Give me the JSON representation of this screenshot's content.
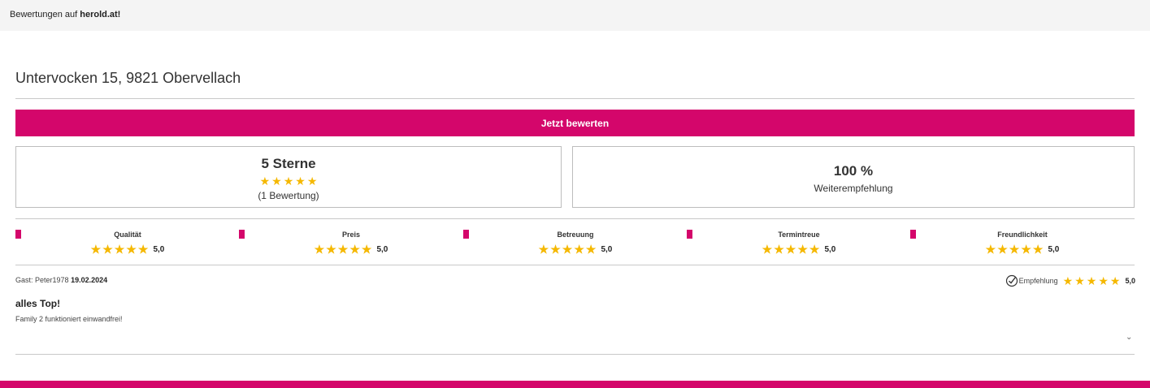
{
  "topbar": {
    "prefix": "Bewertungen auf ",
    "brand": "herold.at!"
  },
  "address": "Untervocken 15, 9821 Obervellach",
  "cta_label": "Jetzt bewerten",
  "summary": {
    "stars_title": "5 Sterne",
    "stars_value": 5,
    "count_label": "(1 Bewertung)",
    "recommend_percent": "100 %",
    "recommend_label": "Weiterempfehlung"
  },
  "categories": [
    {
      "label": "Qualität",
      "value": "5,0",
      "stars": 5
    },
    {
      "label": "Preis",
      "value": "5,0",
      "stars": 5
    },
    {
      "label": "Betreuung",
      "value": "5,0",
      "stars": 5
    },
    {
      "label": "Termintreue",
      "value": "5,0",
      "stars": 5
    },
    {
      "label": "Freundlichkeit",
      "value": "5,0",
      "stars": 5
    }
  ],
  "review": {
    "author": "Gast: Peter1978",
    "date": "19.02.2024",
    "recommend_label": "Empfehlung",
    "stars": 5,
    "value": "5,0",
    "title": "alles Top!",
    "text": "Family 2 funktioniert einwandfrei!"
  },
  "colors": {
    "accent": "#d4066b",
    "star": "#f5b800"
  },
  "icons": {
    "star": "star-icon",
    "check": "check-circle-icon",
    "chevron": "chevron-down-icon"
  }
}
